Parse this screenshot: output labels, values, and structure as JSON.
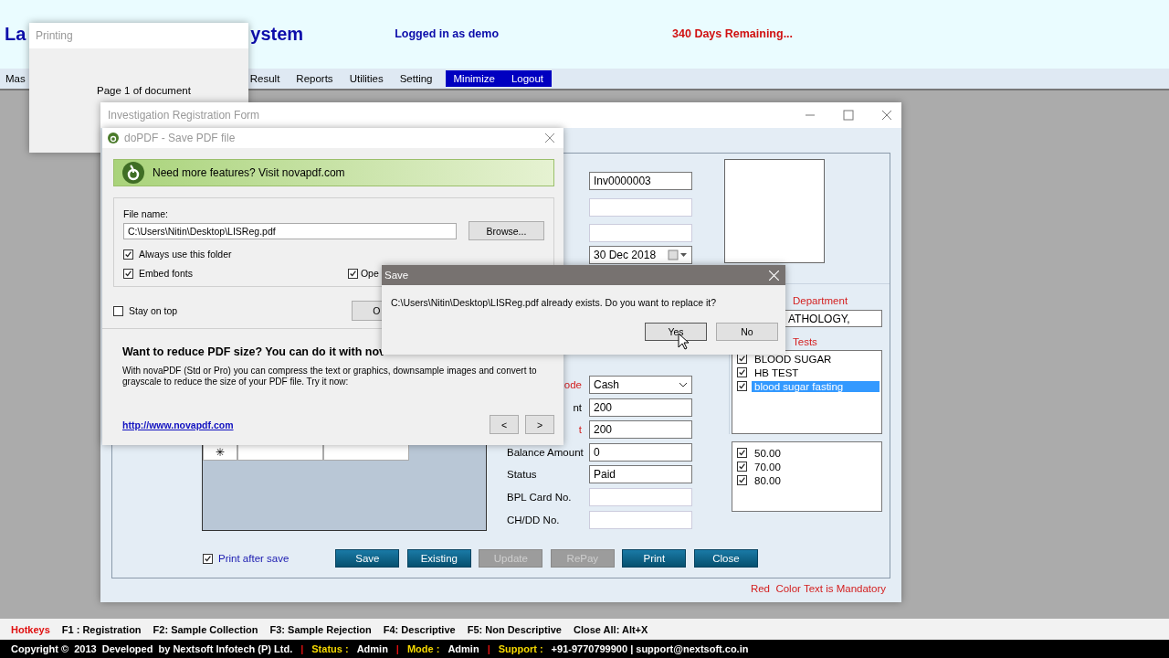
{
  "app_header": {
    "title_parts": [
      "La",
      "ystem"
    ],
    "login": "Logged in as demo",
    "days_remaining": "340 Days Remaining..."
  },
  "menu": [
    {
      "label": "Mas",
      "kind": "plain"
    },
    {
      "label": "Result",
      "kind": "plain"
    },
    {
      "label": "Reports",
      "kind": "plain"
    },
    {
      "label": "Utilities",
      "kind": "plain"
    },
    {
      "label": "Setting",
      "kind": "plain"
    },
    {
      "label": "Minimize",
      "kind": "highlight"
    },
    {
      "label": "Logout",
      "kind": "highlight"
    }
  ],
  "printing_window": {
    "title": "Printing",
    "message": "Page 1 of document"
  },
  "form_window": {
    "title": "Investigation Registration Form",
    "top_fields": [
      {
        "kind": "text",
        "value": "Inv0000003"
      },
      {
        "kind": "text"
      },
      {
        "kind": "text"
      },
      {
        "kind": "date",
        "value": "30 Dec 2018"
      }
    ],
    "payment_rows": [
      {
        "label": "ode",
        "cut": true,
        "mandatory": true,
        "kind": "select",
        "value": "Cash"
      },
      {
        "label": "nt",
        "cut": true,
        "mandatory": false,
        "kind": "text",
        "value": "200"
      },
      {
        "label": "t",
        "cut": true,
        "mandatory": true,
        "kind": "text",
        "value": "200"
      },
      {
        "label": "Balance Amount",
        "cut": false,
        "mandatory": false,
        "kind": "text",
        "value": "0"
      },
      {
        "label": "Status",
        "cut": false,
        "mandatory": false,
        "kind": "text",
        "value": "Paid"
      },
      {
        "label": "BPL Card No.",
        "cut": false,
        "mandatory": false,
        "kind": "text"
      },
      {
        "label": "CH/DD No.",
        "cut": false,
        "mandatory": false,
        "kind": "text"
      }
    ],
    "department": {
      "label": "Department",
      "value": "ATHOLOGY,"
    },
    "tests_label": "Tests",
    "tests": [
      {
        "name": "BLOOD SUGAR",
        "checked": true,
        "selected": false
      },
      {
        "name": "HB TEST",
        "checked": true,
        "selected": false
      },
      {
        "name": "blood sugar fasting",
        "checked": true,
        "selected": true
      }
    ],
    "prices": [
      {
        "value": "50.00",
        "checked": true
      },
      {
        "value": "70.00",
        "checked": true
      },
      {
        "value": "80.00",
        "checked": true
      }
    ],
    "grid": {
      "row_marker": "✳"
    },
    "print_after_save": {
      "label": "Print after save",
      "checked": true
    },
    "buttons": [
      {
        "label": "Save",
        "disabled": false
      },
      {
        "label": "Existing",
        "disabled": false
      },
      {
        "label": "Update",
        "disabled": true
      },
      {
        "label": "RePay",
        "disabled": true
      },
      {
        "label": "Print",
        "disabled": false
      },
      {
        "label": "Close",
        "disabled": false
      }
    ],
    "mandatory_note": "Red  Color Text is Mandatory"
  },
  "dopdf_window": {
    "title": "doPDF - Save PDF file",
    "banner": "Need more features? Visit novapdf.com",
    "file_label": "File name:",
    "file_value": "C:\\Users\\Nitin\\Desktop\\LISReg.pdf",
    "browse": "Browse...",
    "options": [
      {
        "label": "Always use this folder",
        "checked": true
      },
      {
        "label": "Embed fonts",
        "checked": true
      },
      {
        "label": "Ope",
        "checked": true
      }
    ],
    "stay_on_top": {
      "label": "Stay on top",
      "checked": false
    },
    "ok": "O",
    "promo_heading": "Want to reduce PDF size? You can do it with nov",
    "promo_text": "With novaPDF (Std or Pro) you can compress the text or graphics, downsample images and convert to grayscale to reduce the size of your PDF file. Try it now:",
    "link": "http://www.novapdf.com",
    "prev": "<",
    "next": ">"
  },
  "save_dialog": {
    "title": "Save",
    "message": "C:\\Users\\Nitin\\Desktop\\LISReg.pdf already exists. Do you want to replace it?",
    "buttons": [
      "Yes",
      "No"
    ]
  },
  "hotkeys": {
    "title": "Hotkeys",
    "items": [
      "F1 : Registration",
      "F2: Sample Collection",
      "F3: Sample Rejection",
      "F4: Descriptive",
      "F5: Non Descriptive",
      "Close All: Alt+X"
    ]
  },
  "footer": [
    {
      "text": "Copyright ©  2013  Developed  by Nextsoft Infotech (P) Ltd.",
      "kind": "plain"
    },
    {
      "text": "|",
      "kind": "separator"
    },
    {
      "text": "Status :",
      "kind": "key"
    },
    {
      "text": "Admin",
      "kind": "plain"
    },
    {
      "text": "|",
      "kind": "separator"
    },
    {
      "text": "Mode :",
      "kind": "key"
    },
    {
      "text": "Admin",
      "kind": "plain"
    },
    {
      "text": "|",
      "kind": "separator"
    },
    {
      "text": "Support :",
      "kind": "key"
    },
    {
      "text": "+91-9770799900 | support@nextsoft.co.in",
      "kind": "plain"
    }
  ]
}
